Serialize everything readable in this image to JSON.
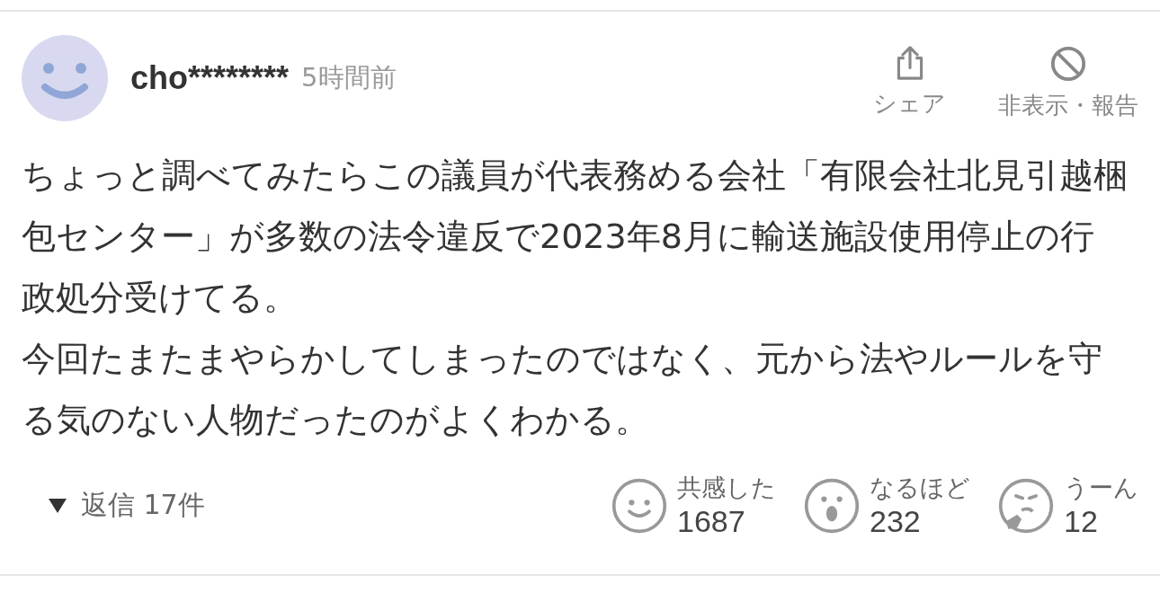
{
  "comment": {
    "user": "cho********",
    "time": "5時間前",
    "actions": [
      {
        "kind": "share",
        "label": "シェア"
      },
      {
        "kind": "hide",
        "label": "非表示・報告"
      }
    ],
    "paragraphs": [
      "ちょっと調べてみたらこの議員が代表務める会社「有限会社北見引越梱包センター」が多数の法令違反で2023年8月に輸送施設使用停止の行政処分受けてる。",
      "今回たまたまやらかしてしまったのではなく、元から法やルールを守る気のない人物だったのがよくわかる。"
    ],
    "replies": {
      "expanded": false,
      "label": "返信 17件"
    },
    "reactions": [
      {
        "kind": "smile",
        "label": "共感した",
        "count": "1687"
      },
      {
        "kind": "surprised",
        "label": "なるほど",
        "count": "232"
      },
      {
        "kind": "doubt",
        "label": "うーん",
        "count": "12"
      }
    ]
  }
}
